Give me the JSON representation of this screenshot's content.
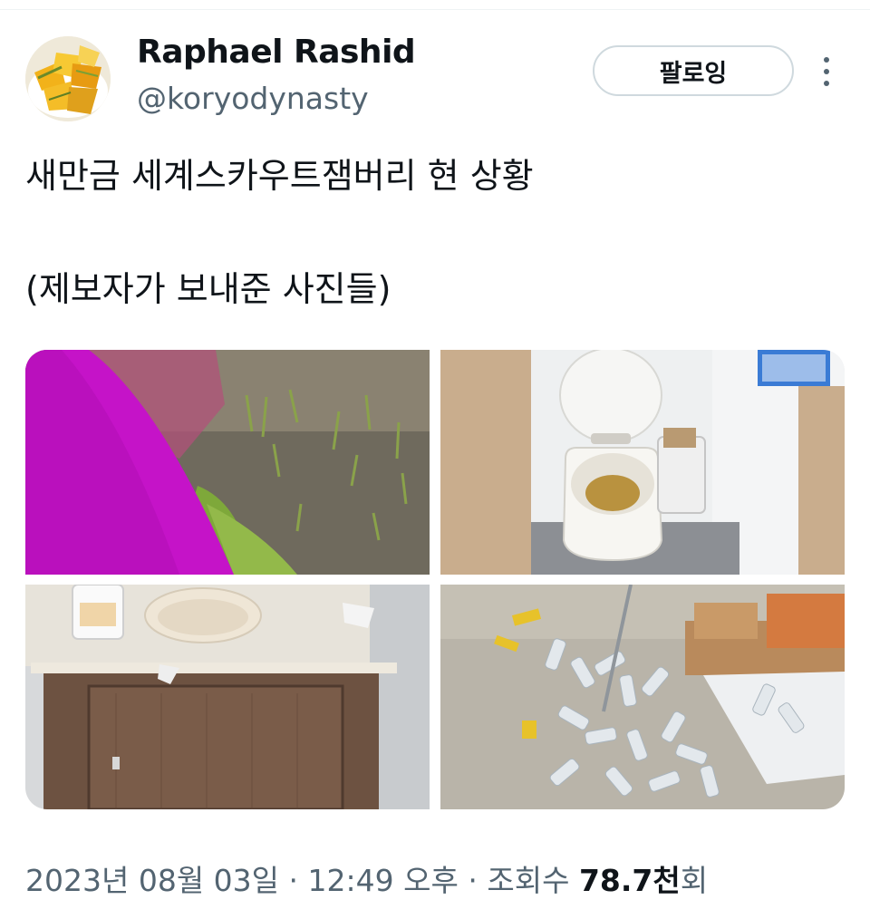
{
  "author": {
    "display_name": "Raphael Rashid",
    "handle": "@koryodynasty",
    "follow_label": "팔로잉"
  },
  "tweet": {
    "line1": "새만금 세계스카우트잼버리 현 상황",
    "line2": "(제보자가 보내준 사진들)"
  },
  "meta": {
    "date": "2023년 08월 03일",
    "separator": "·",
    "time": "12:49 오후",
    "views_label": "조회수",
    "views_value": "78.7천",
    "views_suffix": "회"
  },
  "icons": {
    "avatar": "chips-plate-avatar",
    "more": "more-vertical-icon"
  },
  "colors": {
    "text_primary": "#0f1419",
    "text_secondary": "#536471",
    "border": "#cfd9de"
  }
}
